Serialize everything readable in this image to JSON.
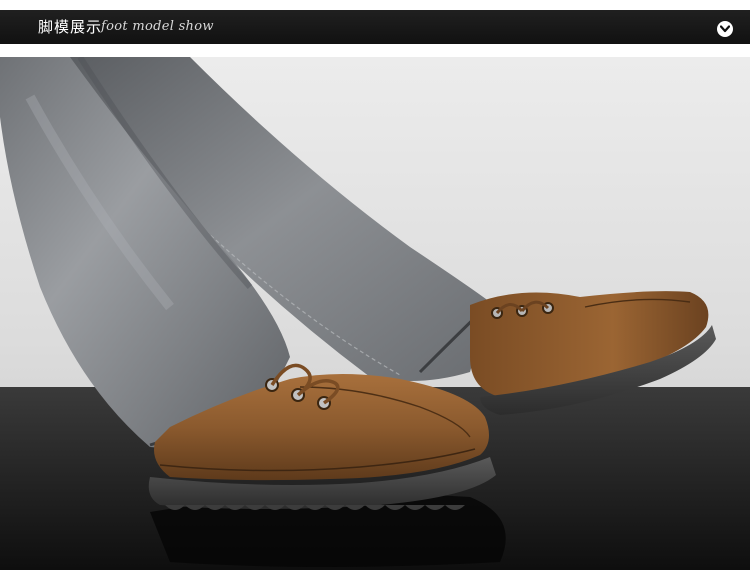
{
  "header": {
    "title_cn": "脚模展示",
    "title_en": "foot model show",
    "toggle_icon": "chevron-down-icon"
  },
  "photo": {
    "subject": "legs in grey jeans wearing brown leather lace-up shoes",
    "colors": {
      "backdrop": "#e2e2e2",
      "floor": "#1a1a1a",
      "denim": "#8a8d91",
      "leather": "#8b5a2e",
      "sole": "#4a4a4a"
    }
  }
}
